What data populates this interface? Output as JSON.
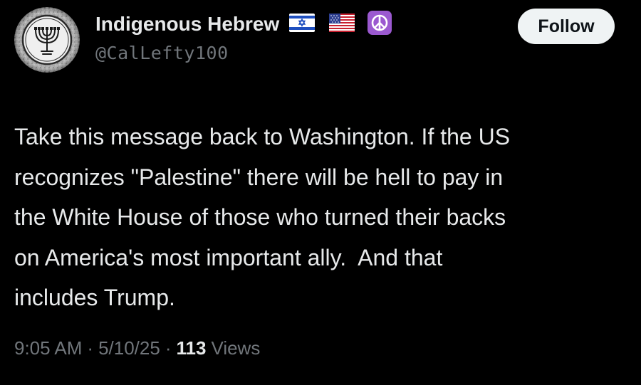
{
  "author": {
    "display_name": "Indigenous Hebrew",
    "handle": "@CalLefty100",
    "name_emojis": [
      "israel-flag-icon",
      "us-flag-icon",
      "peace-symbol-icon"
    ]
  },
  "follow_button": {
    "label": "Follow"
  },
  "tweet": {
    "text": "Take this message back to Washington. If the US\nrecognizes \"Palestine\" there will be hell to pay in\nthe White House of those who turned their backs\non America's most important ally.  And that\nincludes Trump."
  },
  "meta": {
    "time": "9:05 AM",
    "separator": "·",
    "date": "5/10/25",
    "views_count": "113",
    "views_label": "Views"
  },
  "colors": {
    "background": "#000000",
    "text_primary": "#e7e9ea",
    "text_secondary": "#71767b",
    "follow_bg": "#eff3f4",
    "peace_bg": "#9b59d0"
  }
}
